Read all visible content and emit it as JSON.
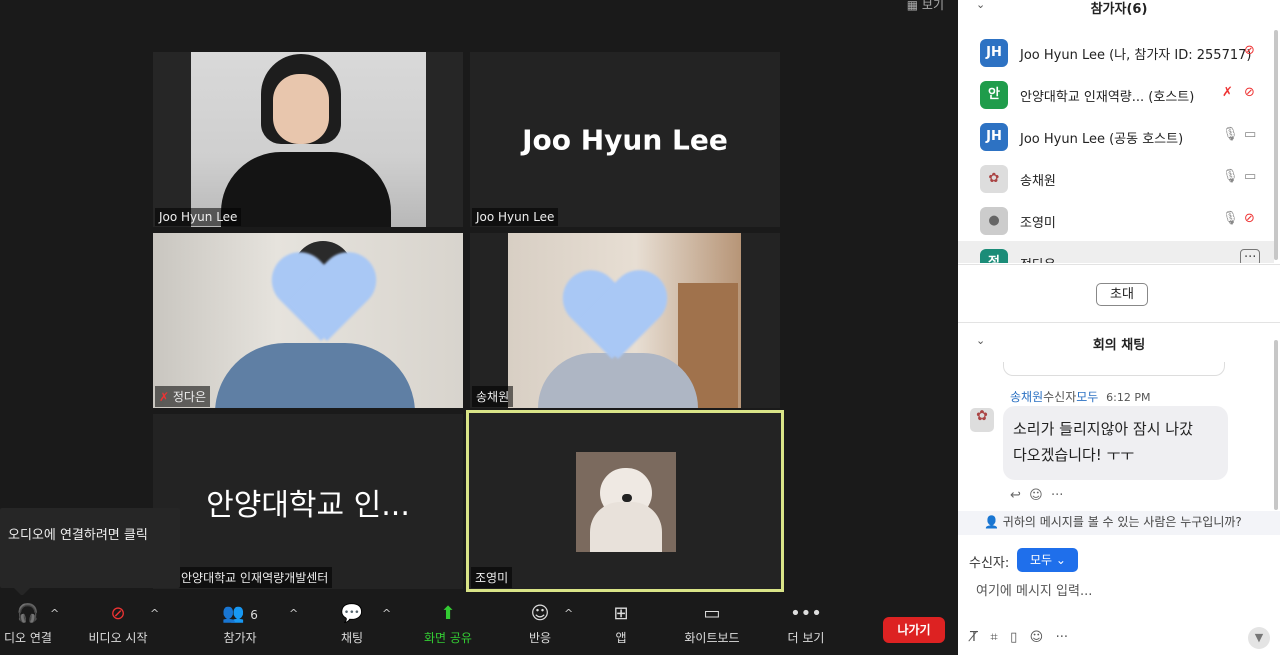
{
  "meeting": {
    "view_label": "보기",
    "tiles": [
      {
        "name": "Joo Hyun Lee",
        "display": ""
      },
      {
        "name": "Joo Hyun Lee",
        "display": "Joo Hyun Lee"
      },
      {
        "name": "정다은",
        "display": ""
      },
      {
        "name": "송채원",
        "display": ""
      },
      {
        "name": "안양대학교 인재역량개발센터",
        "display": "안양대학교 인..."
      },
      {
        "name": "조영미",
        "display": ""
      }
    ],
    "tooltip": "오디오에 연결하려면 클릭"
  },
  "toolbar": {
    "audio": "디오 연결",
    "video": "비디오 시작",
    "participants": "참가자",
    "participants_count": "6",
    "chat": "채팅",
    "share": "화면 공유",
    "reactions": "반응",
    "apps": "앱",
    "whiteboard": "화이트보드",
    "more": "더 보기",
    "leave": "나가기"
  },
  "participants_panel": {
    "title": "참가자(6)",
    "items": [
      {
        "avatar": "JH",
        "name": "Joo Hyun Lee (나, 참가자 ID: 255717)",
        "color": "#2d72c3"
      },
      {
        "avatar": "안",
        "name": "안양대학교 인재역량...  (호스트)",
        "color": "#1f9c4b"
      },
      {
        "avatar": "JH",
        "name": "Joo Hyun Lee (공동 호스트)",
        "color": "#2d72c3"
      },
      {
        "avatar": "",
        "name": "송채원",
        "color": "#ddd"
      },
      {
        "avatar": "",
        "name": "조영미",
        "color": "#ccc"
      },
      {
        "avatar": "정",
        "name": "정다은",
        "color": "#1b8c78"
      }
    ],
    "invite": "초대"
  },
  "chat": {
    "title": "회의 채팅",
    "sender": "송채원",
    "recipient_prefix": "수신자",
    "recipient": "모두",
    "time": "6:12 PM",
    "message_line1": "소리가 들리지않아 잠시 나갔",
    "message_line2": "다오겠습니다! ㅜㅜ",
    "who_can_see": "귀하의 메시지를 볼 수 있는 사람은 누구입니까?",
    "to_label": "수신자:",
    "to_value": "모두",
    "input_placeholder": "여기에 메시지 입력..."
  }
}
